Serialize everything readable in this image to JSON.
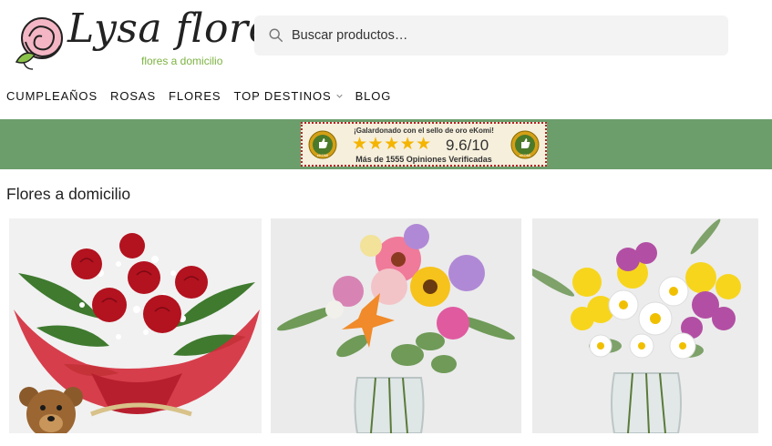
{
  "header": {
    "logo_text": "Lysa flores",
    "logo_subtitle": "flores a domicilio",
    "search_placeholder": "Buscar productos…"
  },
  "nav": {
    "items": [
      {
        "label": "CUMPLEAÑOS",
        "has_dropdown": false
      },
      {
        "label": "ROSAS",
        "has_dropdown": false
      },
      {
        "label": "FLORES",
        "has_dropdown": false
      },
      {
        "label": "TOP DESTINOS",
        "has_dropdown": true
      },
      {
        "label": "BLOG",
        "has_dropdown": false
      }
    ]
  },
  "banner": {
    "top_text": "¡Galardonado con el sello de oro eKomi!",
    "stars": "★★★★★",
    "score": "9.6/10",
    "bottom_text": "Más de 1555 Opiniones Verificadas",
    "seal_text": "eKOMI",
    "background_color": "#6c9e6c"
  },
  "main": {
    "section_title": "Flores a domicilio",
    "products": [
      {
        "image": "red-roses-bouquet-with-teddy-bear"
      },
      {
        "image": "mixed-gerbera-and-lily-bouquet"
      },
      {
        "image": "yellow-and-white-daisy-bouquet"
      }
    ]
  },
  "colors": {
    "brand_green": "#7cb342",
    "logo_rose": "#e0708a",
    "star_gold": "#f4b400"
  }
}
